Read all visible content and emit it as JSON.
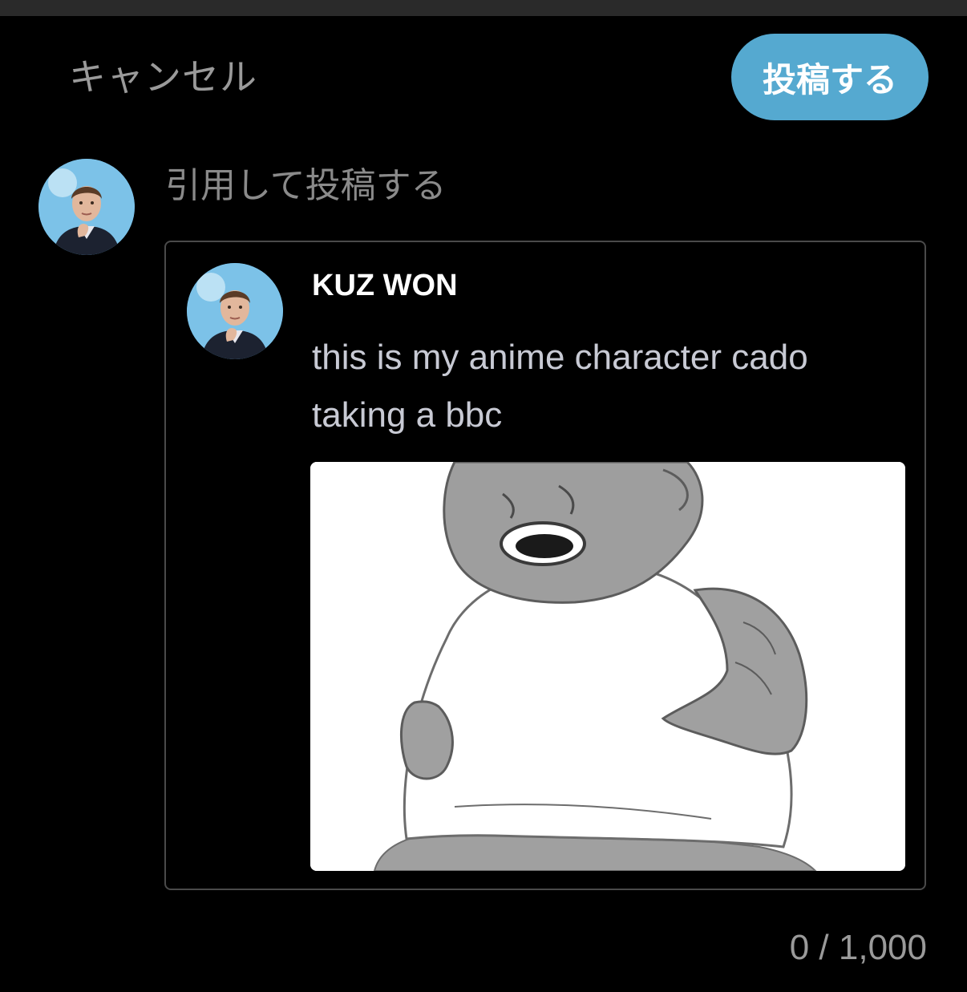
{
  "header": {
    "cancel_label": "キャンセル",
    "post_label": "投稿する"
  },
  "composer": {
    "placeholder": "引用して投稿する",
    "avatar_icon": "user-avatar-icon",
    "character_count": "0 / 1,000"
  },
  "quoted_post": {
    "username": "KUZ WON",
    "text": "this is my anime character cado taking a bbc",
    "image_icon": "cartoon-baby-image"
  },
  "colors": {
    "background": "#000000",
    "accent": "#55a9d0",
    "muted_text": "#9a9a9a",
    "quoted_text": "#c8cad4",
    "card_border": "#4a4a4a"
  }
}
